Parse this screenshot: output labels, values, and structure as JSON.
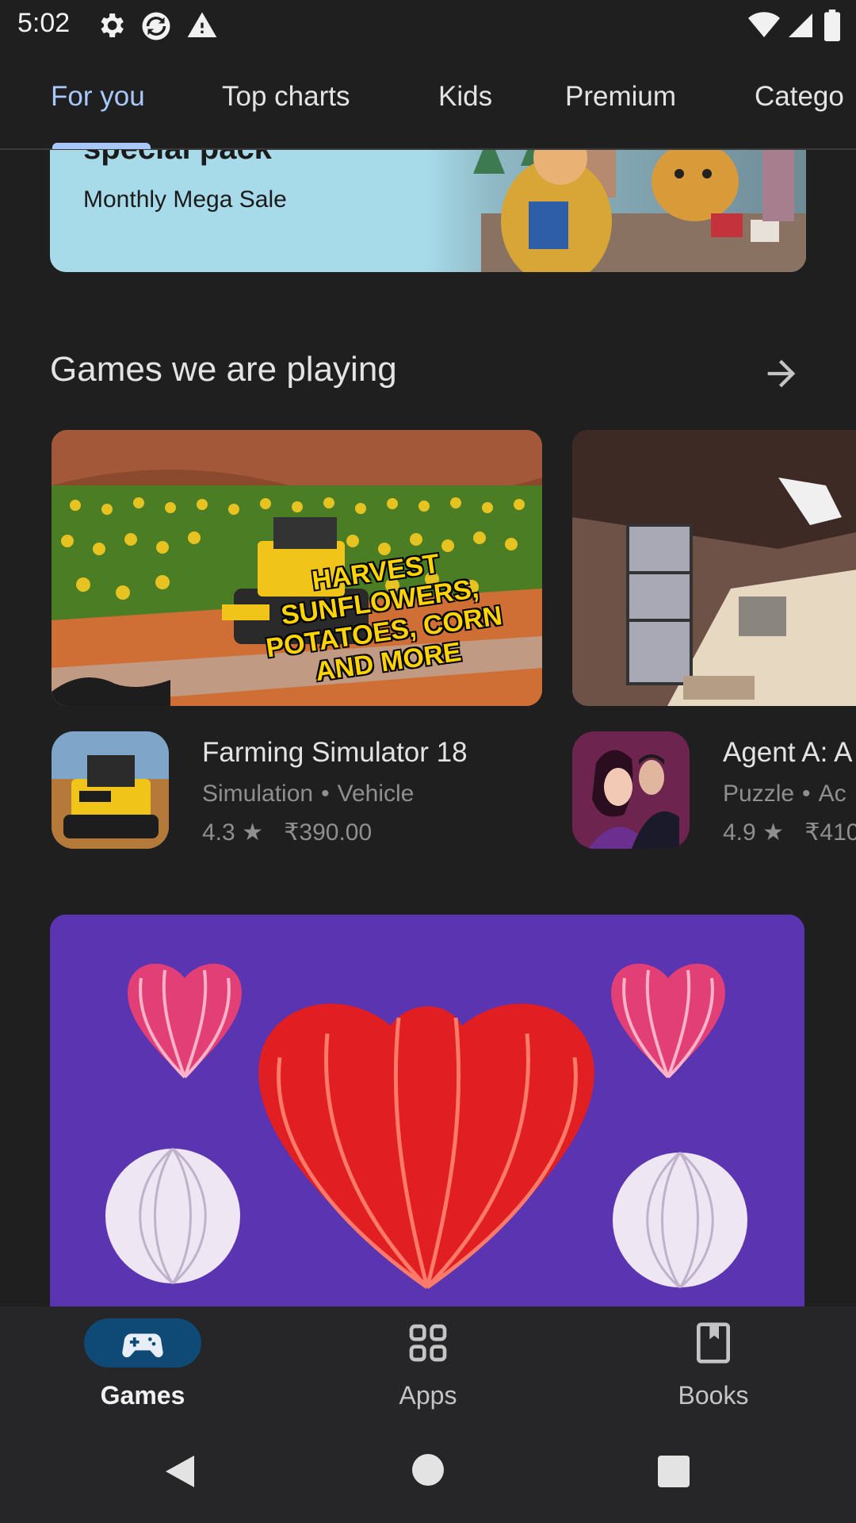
{
  "status_bar": {
    "time": "5:02",
    "left_icons": [
      "gear-icon",
      "sync-icon",
      "warning-icon"
    ],
    "right_icons": [
      "wifi-icon",
      "signal-icon",
      "battery-icon"
    ]
  },
  "tabs": [
    {
      "label": "For you",
      "active": true
    },
    {
      "label": "Top charts",
      "active": false
    },
    {
      "label": "Kids",
      "active": false
    },
    {
      "label": "Premium",
      "active": false
    },
    {
      "label": "Catego",
      "active": false
    }
  ],
  "promo": {
    "title": "special pack",
    "subtitle": "Monthly Mega Sale"
  },
  "section": {
    "title": "Games we are playing",
    "arrow_icon": "arrow-right-icon"
  },
  "games": [
    {
      "banner_text": "HARVEST SUNFLOWERS, POTATOES, CORN AND MORE",
      "name": "Farming Simulator 18",
      "category_1": "Simulation",
      "category_2": "Vehicle",
      "rating": "4.3",
      "price": "₹390.00"
    },
    {
      "name": "Agent A: A",
      "category_1": "Puzzle",
      "category_2": "Ac",
      "rating": "4.9",
      "price": "₹410"
    }
  ],
  "bottom_nav": [
    {
      "label": "Games",
      "icon": "gamepad-icon",
      "active": true
    },
    {
      "label": "Apps",
      "icon": "apps-grid-icon",
      "active": false
    },
    {
      "label": "Books",
      "icon": "bookmark-book-icon",
      "active": false
    }
  ],
  "system_nav": [
    "back-icon",
    "home-icon",
    "recents-icon"
  ],
  "colors": {
    "background": "#1f1f1f",
    "accent": "#a8c7fa",
    "nav_pill": "#0e4a75",
    "promo_bg": "#a7dbea",
    "hearts_bg": "#5b34b2"
  }
}
